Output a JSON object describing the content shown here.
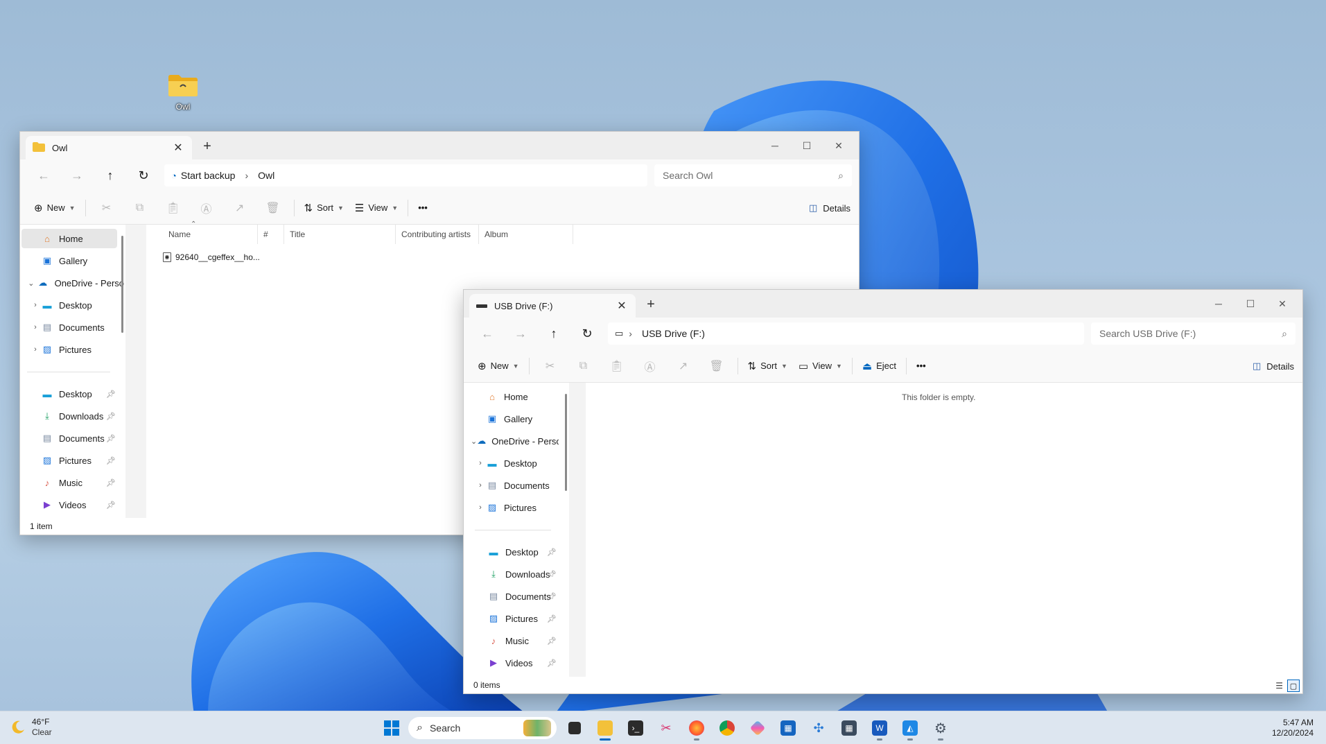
{
  "desktop": {
    "icons": [
      {
        "label": "Owl",
        "icon": "folder-icon"
      }
    ]
  },
  "colors": {
    "accent": "#0067c0",
    "folder": "#f3c13a",
    "wallpaper_blue": "#1f6fe6"
  },
  "window_owl": {
    "tab_title": "Owl",
    "breadcrumb": [
      "Start backup",
      "Owl"
    ],
    "search_placeholder": "Search Owl",
    "toolbar": {
      "new_label": "New",
      "sort_label": "Sort",
      "view_label": "View",
      "details_label": "Details"
    },
    "nav": {
      "tree": [
        {
          "label": "Home",
          "icon": "home-icon"
        },
        {
          "label": "Gallery",
          "icon": "gallery-icon"
        },
        {
          "label": "OneDrive - Perso",
          "icon": "cloud-icon"
        },
        {
          "label": "Desktop",
          "icon": "desktop-folder-icon"
        },
        {
          "label": "Documents",
          "icon": "documents-icon"
        },
        {
          "label": "Pictures",
          "icon": "pictures-icon"
        }
      ],
      "quick": [
        {
          "label": "Desktop",
          "icon": "desktop-folder-icon"
        },
        {
          "label": "Downloads",
          "icon": "download-icon"
        },
        {
          "label": "Documents",
          "icon": "documents-icon"
        },
        {
          "label": "Pictures",
          "icon": "pictures-icon"
        },
        {
          "label": "Music",
          "icon": "music-icon"
        },
        {
          "label": "Videos",
          "icon": "videos-icon"
        }
      ]
    },
    "columns": [
      "Name",
      "#",
      "Title",
      "Contributing artists",
      "Album"
    ],
    "files": [
      {
        "name": "92640__cgeffex__ho...",
        "icon": "audio-file-icon"
      }
    ],
    "status": "1 item"
  },
  "window_usb": {
    "tab_title": "USB Drive (F:)",
    "breadcrumb": [
      "USB Drive (F:)"
    ],
    "search_placeholder": "Search USB Drive (F:)",
    "toolbar": {
      "new_label": "New",
      "sort_label": "Sort",
      "view_label": "View",
      "eject_label": "Eject",
      "details_label": "Details"
    },
    "nav": {
      "tree": [
        {
          "label": "Home",
          "icon": "home-icon"
        },
        {
          "label": "Gallery",
          "icon": "gallery-icon"
        },
        {
          "label": "OneDrive - Perso",
          "icon": "cloud-icon"
        },
        {
          "label": "Desktop",
          "icon": "desktop-folder-icon"
        },
        {
          "label": "Documents",
          "icon": "documents-icon"
        },
        {
          "label": "Pictures",
          "icon": "pictures-icon"
        }
      ],
      "quick": [
        {
          "label": "Desktop",
          "icon": "desktop-folder-icon"
        },
        {
          "label": "Downloads",
          "icon": "download-icon"
        },
        {
          "label": "Documents",
          "icon": "documents-icon"
        },
        {
          "label": "Pictures",
          "icon": "pictures-icon"
        },
        {
          "label": "Music",
          "icon": "music-icon"
        },
        {
          "label": "Videos",
          "icon": "videos-icon"
        }
      ]
    },
    "empty_message": "This folder is empty.",
    "status": "0 items"
  },
  "taskbar": {
    "weather": {
      "temp": "46°F",
      "condition": "Clear"
    },
    "search_label": "Search",
    "apps": [
      "task-view-icon",
      "file-explorer-icon",
      "terminal-icon",
      "snipping-tool-icon",
      "firefox-icon",
      "chrome-icon",
      "copilot-icon",
      "store-icon",
      "settings-app-icon",
      "calculator-icon",
      "word-icon",
      "photos-icon",
      "gear-icon"
    ],
    "time": "5:47 AM",
    "date": "12/20/2024"
  }
}
